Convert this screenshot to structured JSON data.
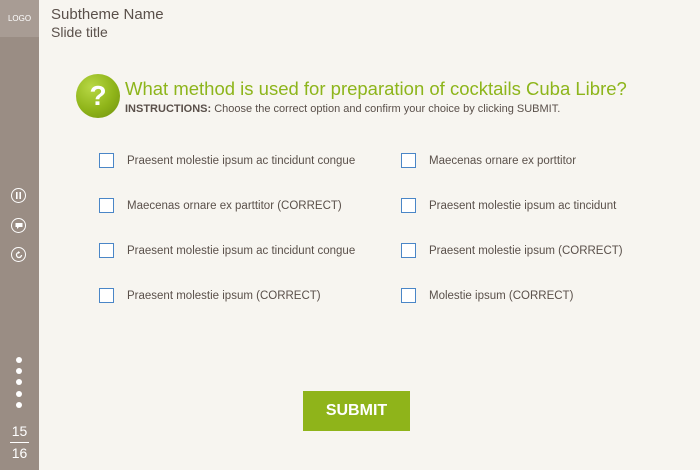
{
  "sidebar": {
    "logo": "LOGO",
    "controls": [
      "pause-icon",
      "comment-icon",
      "replay-icon"
    ],
    "page_current": "15",
    "page_total": "16"
  },
  "header": {
    "subtheme": "Subtheme Name",
    "slide_title": "Slide title"
  },
  "question": {
    "badge": "?",
    "text": "What method is used for preparation of cocktails Cuba Libre?",
    "instructions_label": "INSTRUCTIONS:",
    "instructions_text": " Choose the correct option and confirm your choice by clicking SUBMIT."
  },
  "options": [
    "Praesent molestie ipsum ac tincidunt congue",
    "Maecenas ornare ex porttitor",
    "Maecenas ornare ex parttitor (CORRECT)",
    "Praesent molestie ipsum ac tincidunt",
    "Praesent molestie ipsum ac tincidunt congue",
    "Praesent molestie ipsum (CORRECT)",
    "Praesent molestie ipsum (CORRECT)",
    "Molestie ipsum (CORRECT)"
  ],
  "submit_label": "SUBMIT",
  "colors": {
    "accent": "#8fb41a",
    "sidebar": "#9a8d84",
    "checkbox": "#4a86c7"
  }
}
